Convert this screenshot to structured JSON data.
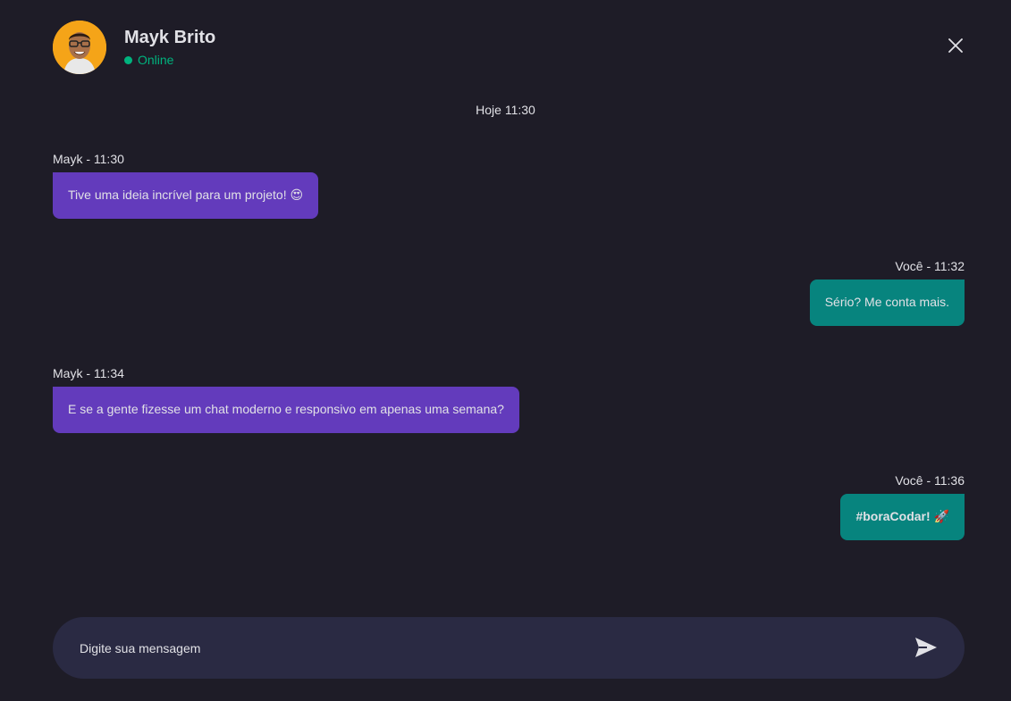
{
  "header": {
    "contact_name": "Mayk Brito",
    "status": "Online",
    "avatar_icon": "user-avatar",
    "close_icon": "close-icon"
  },
  "date_divider": "Hoje 11:30",
  "messages": [
    {
      "author_time": "Mayk - 11:30",
      "text": "Tive uma ideia incrível para um projeto! 😍",
      "side": "received"
    },
    {
      "author_time": "Você - 11:32",
      "text": "Sério? Me conta mais.",
      "side": "sent"
    },
    {
      "author_time": "Mayk - 11:34",
      "text": "E se a gente fizesse um chat moderno e responsivo em apenas uma semana?",
      "side": "received"
    },
    {
      "author_time": "Você - 11:36",
      "text": "#boraCodar! 🚀",
      "side": "sent"
    }
  ],
  "composer": {
    "placeholder": "Digite sua mensagem",
    "send_icon": "send-icon"
  },
  "colors": {
    "background": "#1e1c27",
    "received_bubble": "#633bbc",
    "sent_bubble": "#07847e",
    "online": "#00b37e",
    "input_bg": "#2a2a43"
  }
}
